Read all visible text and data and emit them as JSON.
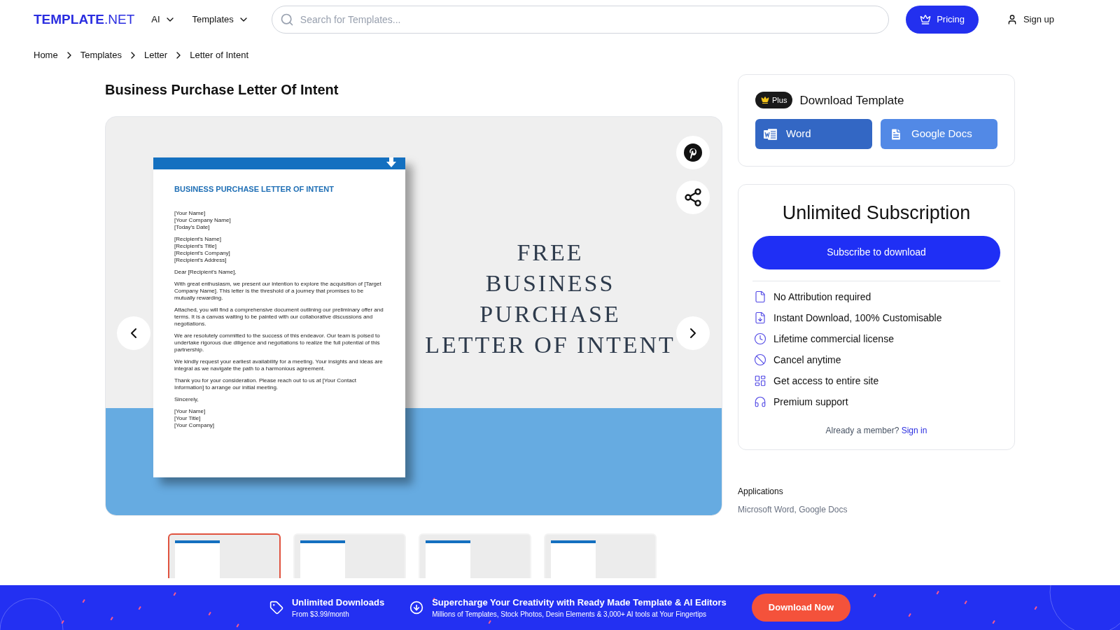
{
  "header": {
    "logo_bold": "TEMPLATE",
    "logo_rest": ".NET",
    "menus": [
      {
        "label": "AI"
      },
      {
        "label": "Templates"
      }
    ],
    "search": {
      "placeholder": "Search for Templates..."
    },
    "pricing": "Pricing",
    "signup": "Sign up"
  },
  "breadcrumb": [
    "Home",
    "Templates",
    "Letter",
    "Letter of Intent"
  ],
  "title": "Business Purchase Letter Of Intent",
  "preview": {
    "letter": {
      "heading": "BUSINESS PURCHASE LETTER OF INTENT",
      "blocks": [
        {
          "lines": [
            "[Your Name]",
            "[Your Company Name]",
            "[Today's Date]"
          ]
        },
        {
          "lines": [
            "[Recipient's Name]",
            "[Recipient's Title]",
            "[Recipient's Company]",
            "[Recipient's Address]"
          ]
        },
        {
          "lines": [
            "Dear [Recipient's Name],"
          ]
        },
        {
          "lines": [
            "With great enthusiasm, we present our intention to explore the acquisition of [Target Company Name]. This letter is the threshold of a journey that promises to be mutually rewarding."
          ]
        },
        {
          "lines": [
            "Attached, you will find a comprehensive document outlining our preliminary offer and terms. It is a canvas waiting to be painted with our collaborative discussions and negotiations."
          ]
        },
        {
          "lines": [
            "We are resolutely committed to the success of this endeavor. Our team is poised to undertake rigorous due diligence and negotiations to realize the full potential of this partnership."
          ]
        },
        {
          "lines": [
            "We kindly request your earliest availability for a meeting. Your insights and ideas are integral as we navigate the path to a harmonious agreement."
          ]
        },
        {
          "lines": [
            "Thank you for your consideration. Please reach out to us at [Your Contact Information] to arrange our initial meeting."
          ]
        },
        {
          "lines": [
            "Sincerely,"
          ]
        },
        {
          "lines": [
            "[Your Name]",
            "[Your Title]",
            "[Your Company]"
          ]
        }
      ]
    },
    "cover_lines": [
      "FREE",
      "BUSINESS",
      "PURCHASE",
      "LETTER OF INTENT"
    ]
  },
  "thumbnails": [
    {
      "selected": true
    },
    {
      "selected": false
    },
    {
      "selected": false
    },
    {
      "selected": false
    }
  ],
  "download": {
    "badge": "Plus",
    "title": "Download Template",
    "buttons": [
      {
        "kind": "word",
        "label": "Word"
      },
      {
        "kind": "gdocs",
        "label": "Google Docs"
      }
    ]
  },
  "subscription": {
    "title": "Unlimited Subscription",
    "button": "Subscribe to download",
    "features": [
      {
        "kind": "file",
        "label": "No Attribution required"
      },
      {
        "kind": "download",
        "label": "Instant Download, 100% Customisable"
      },
      {
        "kind": "clock",
        "label": "Lifetime commercial license"
      },
      {
        "kind": "cancel",
        "label": "Cancel anytime"
      },
      {
        "kind": "site",
        "label": "Get access to entire site"
      },
      {
        "kind": "support",
        "label": "Premium support"
      }
    ],
    "member_text": "Already a member?",
    "signin": "Sign in"
  },
  "applications": {
    "label": "Applications",
    "value": "Microsoft Word, Google Docs"
  },
  "banner": {
    "items": [
      {
        "kind": "tag",
        "title": "Unlimited Downloads",
        "subtitle": "From $3.99/month"
      },
      {
        "kind": "download",
        "title": "Supercharge Your Creativity with Ready Made Template & AI Editors",
        "subtitle": "Millions of Templates, Stock Photos, Desin Elements & 3,000+ AI tools at Your Fingertips"
      }
    ],
    "button": "Download Now"
  }
}
